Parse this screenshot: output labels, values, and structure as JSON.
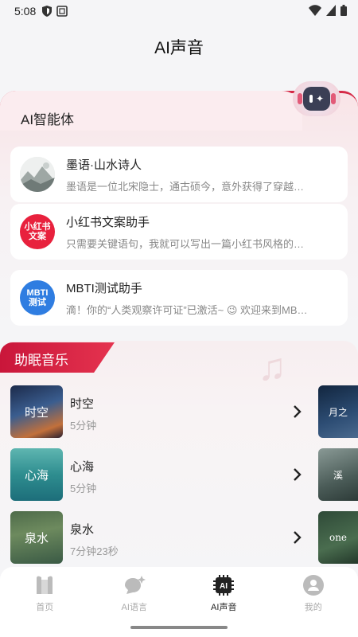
{
  "status_bar": {
    "time": "5:08"
  },
  "page_title": "AI声音",
  "agents": {
    "section_title": "AI智能体",
    "items": [
      {
        "name": "墨语·山水诗人",
        "desc": "墨语是一位北宋隐士，通古硕今，意外获得了穿越…",
        "avatar_text": "",
        "avatar_color": "#dfe3e2"
      },
      {
        "name": "小红书文案助手",
        "desc": "只需要关键语句，我就可以写出一篇小红书风格的…",
        "avatar_text": "小红书\n文案",
        "avatar_color": "#e8213d"
      },
      {
        "name": "MBTI测试助手",
        "desc": "滴！你的“人类观察许可证”已激活~ 😉 欢迎来到MB…",
        "avatar_text": "MBTI\n测试",
        "avatar_color": "#2f7de1"
      }
    ]
  },
  "music": {
    "section_title": "助眠音乐",
    "items": [
      {
        "name": "时空",
        "duration": "5分钟",
        "thumb_text": "时空",
        "side_text": "月之"
      },
      {
        "name": "心海",
        "duration": "5分钟",
        "thumb_text": "心海",
        "side_text": "溪"
      },
      {
        "name": "泉水",
        "duration": "7分钟23秒",
        "thumb_text": "泉水",
        "side_text": "one"
      }
    ]
  },
  "nav": {
    "items": [
      {
        "label": "首页",
        "icon": "home-icon"
      },
      {
        "label": "AI语言",
        "icon": "ai-chat-icon"
      },
      {
        "label": "AI声音",
        "icon": "ai-chip-icon"
      },
      {
        "label": "我的",
        "icon": "profile-icon"
      }
    ],
    "active": "AI声音"
  },
  "colors": {
    "accent": "#d52a47",
    "background": "#f5f5f7"
  }
}
